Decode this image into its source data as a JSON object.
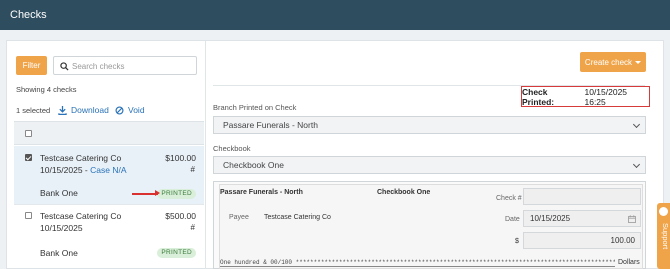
{
  "header": {
    "title": "Checks"
  },
  "left": {
    "filter_label": "Filter",
    "search_placeholder": "Search checks",
    "showing_text": "Showing 4 checks",
    "selected_text": "1 selected",
    "download_label": "Download",
    "void_label": "Void",
    "rows": [
      {
        "name": "Testcase Catering Co",
        "date": "10/15/2025",
        "case_sep": " - ",
        "case": "Case N/A",
        "amount": "$100.00",
        "hash": "#",
        "bank": "Bank One",
        "status": "PRINTED",
        "checked": true
      },
      {
        "name": "Testcase Catering Co",
        "date": "10/15/2025",
        "case_sep": "",
        "case": "",
        "amount": "$500.00",
        "hash": "#",
        "bank": "Bank One",
        "status": "PRINTED",
        "checked": false
      }
    ]
  },
  "right": {
    "create_label": "Create check",
    "printed_label": "Check Printed:",
    "printed_value": "10/15/2025 16:25",
    "branch_label": "Branch Printed on Check",
    "branch_value": "Passare Funerals - North",
    "checkbook_label": "Checkbook",
    "checkbook_value": "Checkbook One",
    "preview": {
      "org": "Passare Funerals - North",
      "checkbook": "Checkbook One",
      "check_no_label": "Check #",
      "check_no_value": "",
      "payee_label": "Payee",
      "payee_value": "Testcase Catering Co",
      "date_label": "Date",
      "date_value": "10/15/2025",
      "dollar_sign": "$",
      "amount_value": "100.00",
      "words": "One hundred & 00/100 *********************************************************************************************************",
      "dollars_label": "Dollars"
    }
  },
  "support_label": "Support",
  "colors": {
    "header_bg": "#2e4d5e",
    "accent": "#f0a44a",
    "link": "#2a73b8",
    "highlight_border": "#d63a3a",
    "printed_badge_bg": "#d9efd9"
  },
  "icons": [
    "search-icon",
    "download-icon",
    "void-icon",
    "calendar-icon",
    "chevron-down-icon"
  ]
}
